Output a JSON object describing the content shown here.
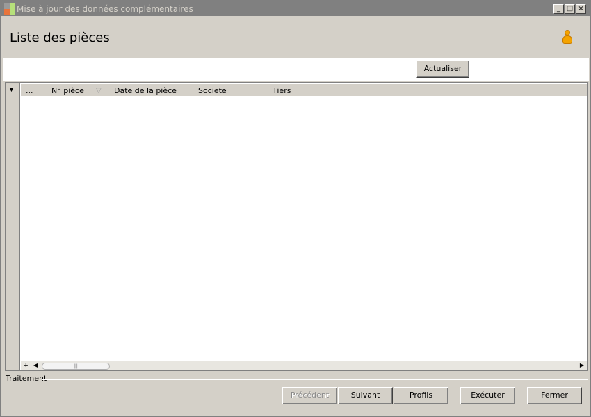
{
  "window": {
    "title": "Mise à jour des données complémentaires",
    "controls": {
      "minimize": "_",
      "maximize": "□",
      "close": "×"
    }
  },
  "header": {
    "title": "Liste des pièces",
    "user_icon": "user-icon"
  },
  "toolbar": {
    "refresh_label": "Actualiser"
  },
  "grid": {
    "columns": [
      "...",
      "N° pièce",
      "Date de la pièce",
      "Societe",
      "Tiers"
    ],
    "rows": [],
    "scroll_thumb_grip": "|||"
  },
  "footer": {
    "section_label": "Traitement",
    "buttons": {
      "previous": "Précédent",
      "next": "Suivant",
      "profiles": "Profils",
      "execute": "Exécuter",
      "close": "Fermer"
    }
  }
}
